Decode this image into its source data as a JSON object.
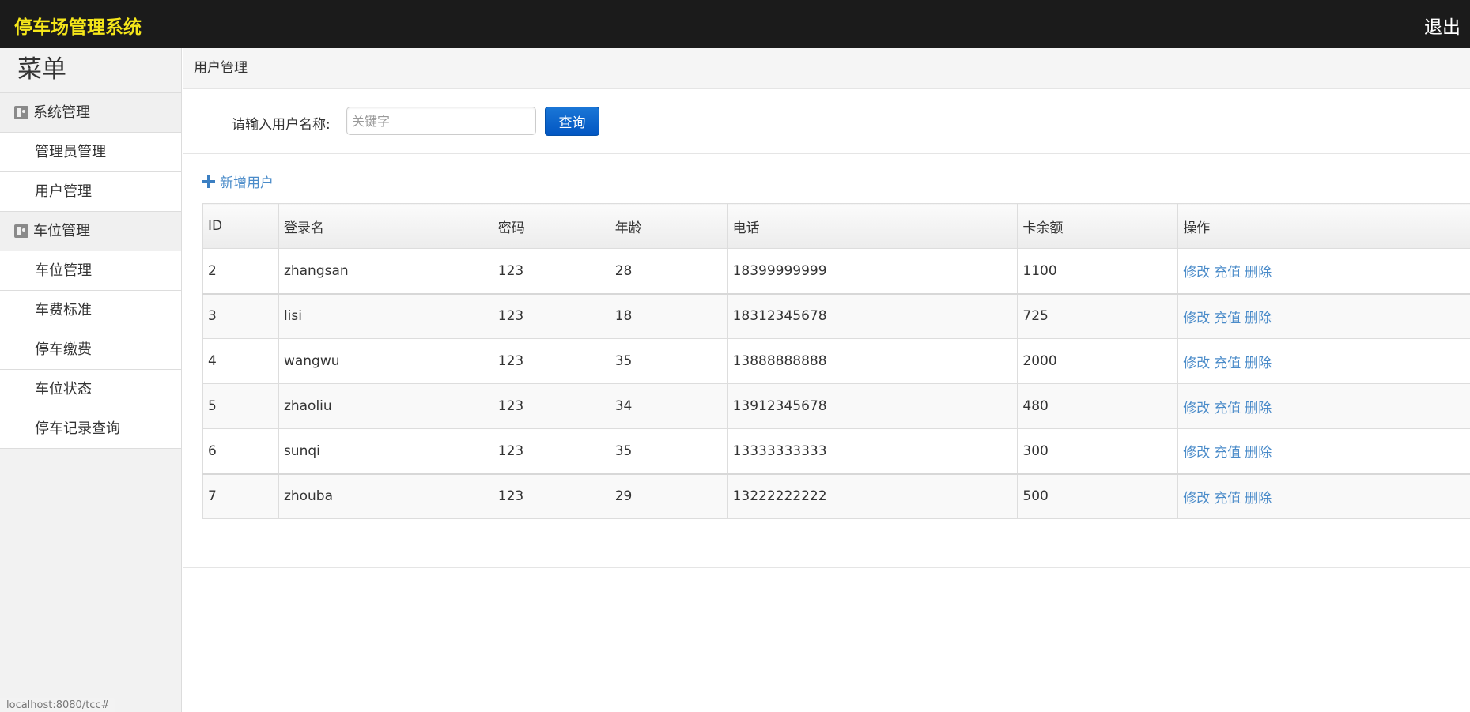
{
  "header": {
    "app_title": "停车场管理系统",
    "logout_label": "退出"
  },
  "sidebar": {
    "menu_title": "菜单",
    "groups": [
      {
        "label": "系统管理",
        "items": [
          "管理员管理",
          "用户管理"
        ]
      },
      {
        "label": "车位管理",
        "items": [
          "车位管理",
          "车费标准",
          "停车缴费",
          "车位状态",
          "停车记录查询"
        ]
      }
    ]
  },
  "breadcrumb": "用户管理",
  "search": {
    "label": "请输入用户名称:",
    "placeholder": "关键字",
    "value": "",
    "button_label": "查询"
  },
  "add_user_label": "新增用户",
  "table": {
    "headers": [
      "ID",
      "登录名",
      "密码",
      "年龄",
      "电话",
      "卡余额",
      "操作"
    ],
    "actions": [
      "修改",
      "充值",
      "删除"
    ],
    "rows": [
      [
        "2",
        "zhangsan",
        "123",
        "28",
        "18399999999",
        "1100"
      ],
      [
        "3",
        "lisi",
        "123",
        "18",
        "18312345678",
        "725"
      ],
      [
        "4",
        "wangwu",
        "123",
        "35",
        "13888888888",
        "2000"
      ],
      [
        "5",
        "zhaoliu",
        "123",
        "34",
        "13912345678",
        "480"
      ],
      [
        "6",
        "sunqi",
        "123",
        "35",
        "13333333333",
        "300"
      ],
      [
        "7",
        "zhouba",
        "123",
        "29",
        "13222222222",
        "500"
      ]
    ]
  },
  "status_url": "localhost:8080/tcc#"
}
